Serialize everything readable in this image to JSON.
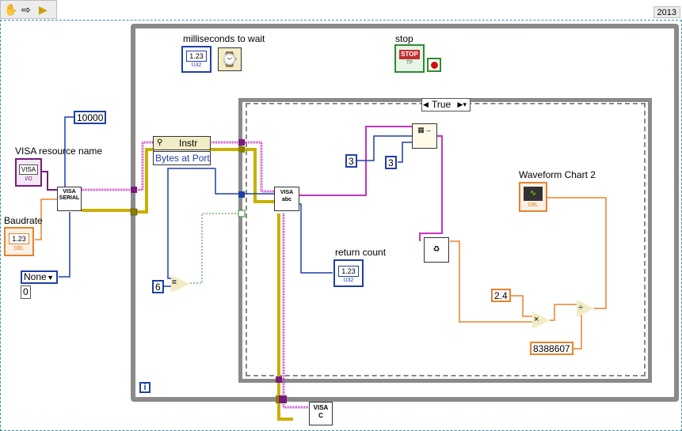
{
  "app": {
    "version_label": "2013"
  },
  "toolbar": {
    "icons": [
      "hand-icon",
      "arrow-right-icon",
      "run-arrow-icon"
    ]
  },
  "labels": {
    "milliseconds": "milliseconds to wait",
    "stop": "stop",
    "visa_resource": "VISA resource name",
    "baudrate": "Baudrate",
    "waveform_chart": "Waveform Chart 2",
    "return_count": "return count"
  },
  "constants": {
    "timeout": "10000",
    "three_a": "3",
    "three_b": "3",
    "six": "6",
    "gain": "2.4",
    "full_scale": "8388607",
    "parity_value": "None",
    "zero": "0"
  },
  "nodes": {
    "visa_serial": "VISA\nSERIAL",
    "property_node_class": "Instr",
    "property_node_prop": "Bytes at Port",
    "visa_read": "VISA\nabc",
    "visa_close": "VISA\nC"
  },
  "terminals": {
    "u32": "U32",
    "dbl": "DBL",
    "tf": "TF",
    "io": "I/O",
    "numeric": "1.23",
    "stop_text": "STOP",
    "visa_text": "VISA"
  },
  "case_structure": {
    "selector_value": "True"
  },
  "while_loop": {
    "iteration_label": "i"
  },
  "colors": {
    "loop_border": "#8a8a8a",
    "case_border": "#8a8a8a",
    "blue_wire": "#1f3fa6",
    "orange_wire": "#e8822c",
    "pink_wire": "#c235c2",
    "visa_wire": "#7a1a7a",
    "error_wire": "#c8b000",
    "bool_wire": "#2e8b2e"
  }
}
